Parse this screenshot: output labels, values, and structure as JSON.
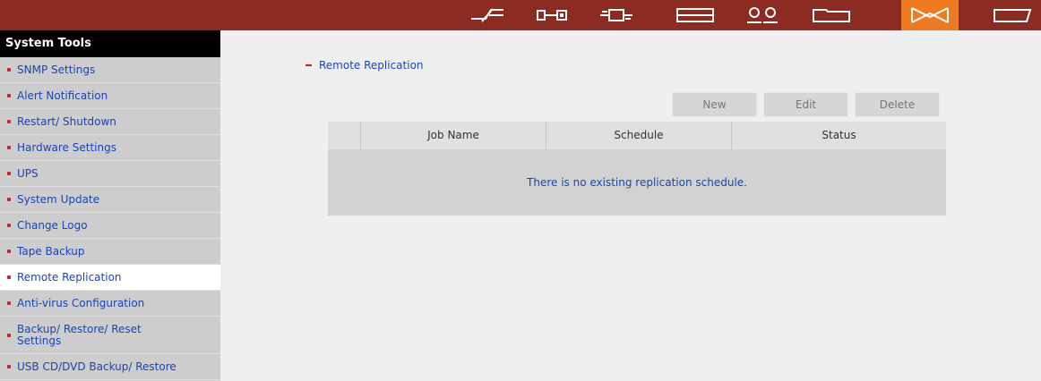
{
  "topbar": {
    "icons": [
      {
        "name": "bolt-icon"
      },
      {
        "name": "network-icon"
      },
      {
        "name": "connector-icon"
      },
      {
        "name": "disk-icon"
      },
      {
        "name": "users-icon"
      },
      {
        "name": "folder-icon"
      },
      {
        "name": "system-tools-icon"
      },
      {
        "name": "tag-icon"
      }
    ],
    "active_color": "#ee7b22",
    "bar_color": "#8b2b22"
  },
  "sidebar": {
    "title": "System Tools",
    "items": [
      {
        "label": "SNMP Settings"
      },
      {
        "label": "Alert Notification"
      },
      {
        "label": "Restart/ Shutdown"
      },
      {
        "label": "Hardware Settings"
      },
      {
        "label": "UPS"
      },
      {
        "label": "System Update"
      },
      {
        "label": "Change Logo"
      },
      {
        "label": "Tape Backup"
      },
      {
        "label": "Remote Replication"
      },
      {
        "label": "Anti-virus Configuration"
      },
      {
        "label": "Backup/ Restore/ Reset Settings"
      },
      {
        "label": "USB CD/DVD Backup/ Restore"
      }
    ],
    "active_item": "Remote Replication"
  },
  "main": {
    "breadcrumb": "Remote Replication",
    "buttons": {
      "new": "New",
      "edit": "Edit",
      "delete": "Delete"
    },
    "table": {
      "columns": [
        "Job Name",
        "Schedule",
        "Status"
      ],
      "empty_message": "There is no existing replication schedule."
    }
  }
}
